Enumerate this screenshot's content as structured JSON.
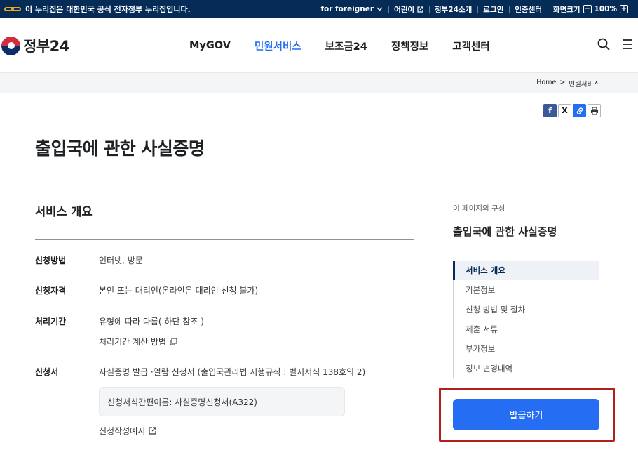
{
  "topbar": {
    "gov_notice": "이 누리집은 대한민국 공식 전자정부 누리집입니다.",
    "links": [
      "for foreigner",
      "어린이",
      "정부24소개",
      "로그인",
      "인증센터"
    ],
    "font_size_label": "화면크기",
    "zoom_minus": "−",
    "zoom_value": "100%",
    "zoom_plus": "+"
  },
  "header": {
    "logo_text": "정부24",
    "nav": [
      "MyGOV",
      "민원서비스",
      "보조금24",
      "정책정보",
      "고객센터"
    ],
    "active_nav": "민원서비스"
  },
  "breadcrumb": {
    "home": "Home",
    "sep": ">",
    "current": "민원서비스"
  },
  "share": {
    "facebook": "f",
    "x": "X",
    "link": "🔗",
    "print": "🖶"
  },
  "page_title": "출입국에 관한 사실증명",
  "overview": {
    "title": "서비스 개요",
    "rows": [
      {
        "label": "신청방법",
        "value": "인터넷, 방문"
      },
      {
        "label": "신청자격",
        "value": "본인 또는 대리인(온라인은 대리인 신청 불가)"
      },
      {
        "label": "처리기간",
        "value": "유형에 따라 다름( 하단 참조 )",
        "link": "처리기간 계산 방법"
      },
      {
        "label": "신청서",
        "value": "사실증명 발급 ·열람 신청서 (출입국관리법 시행규칙 : 별지서식 138호의 2)",
        "box": "신청서식간편이름: 사실증명신청서(A322)",
        "link": "신청작성예시"
      }
    ]
  },
  "toc": {
    "caption": "이 페이지의 구성",
    "title": "출입국에 관한 사실증명",
    "items": [
      "서비스 개요",
      "기본정보",
      "신청 방법 및 절차",
      "제출 서류",
      "부가정보",
      "정보 변경내역"
    ]
  },
  "issue_button": "발급하기"
}
